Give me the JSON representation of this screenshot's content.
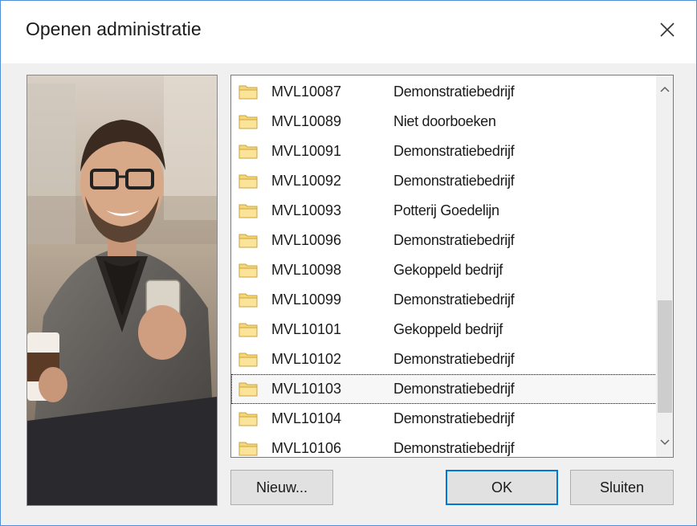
{
  "window": {
    "title": "Openen administratie",
    "close_icon": "close-icon"
  },
  "list": {
    "selected_index": 10,
    "items": [
      {
        "code": "MVL10087",
        "name": "Demonstratiebedrijf"
      },
      {
        "code": "MVL10089",
        "name": "Niet doorboeken"
      },
      {
        "code": "MVL10091",
        "name": "Demonstratiebedrijf"
      },
      {
        "code": "MVL10092",
        "name": "Demonstratiebedrijf"
      },
      {
        "code": "MVL10093",
        "name": "Potterij Goedelijn"
      },
      {
        "code": "MVL10096",
        "name": "Demonstratiebedrijf"
      },
      {
        "code": "MVL10098",
        "name": "Gekoppeld bedrijf"
      },
      {
        "code": "MVL10099",
        "name": "Demonstratiebedrijf"
      },
      {
        "code": "MVL10101",
        "name": "Gekoppeld bedrijf"
      },
      {
        "code": "MVL10102",
        "name": "Demonstratiebedrijf"
      },
      {
        "code": "MVL10103",
        "name": "Demonstratiebedrijf"
      },
      {
        "code": "MVL10104",
        "name": "Demonstratiebedrijf"
      },
      {
        "code": "MVL10106",
        "name": "Demonstratiebedrijf"
      }
    ]
  },
  "buttons": {
    "new_label": "Nieuw...",
    "ok_label": "OK",
    "close_label": "Sluiten"
  },
  "colors": {
    "window_border": "#4f8fd8",
    "default_button_border": "#0078d7",
    "folder_fill": "#f5d77a",
    "folder_stroke": "#c9a43c"
  }
}
